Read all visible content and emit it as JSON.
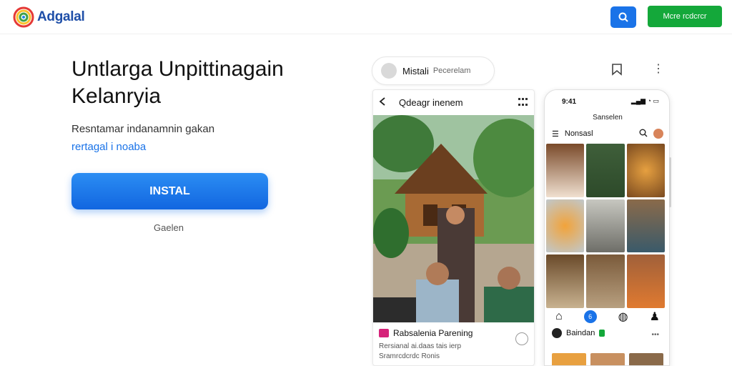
{
  "header": {
    "brand": "Adgalal",
    "more_label": "Mcre rcdcrcr"
  },
  "hero": {
    "headline": "Untlarga Unpittinagain Kelanryia",
    "subtitle": "Resntamar indanamnin gakan",
    "link": "rertagal i noaba",
    "install_label": "INSTAL",
    "secondary_label": "Gaelen"
  },
  "post": {
    "author": "Mistali",
    "author_sub": "Pecerelam",
    "search_label": "Qdeagr inenem",
    "caption_title": "Rabsalenia Parening",
    "caption_line1": "Rersianal ai.daas tais ierp",
    "caption_line2": "Sramrcdcrdc Ronis"
  },
  "phone": {
    "time": "9:41",
    "title": "Sanselen",
    "nav_label": "Nonsasl",
    "tab_badge": "6",
    "foot_name": "Baindan",
    "foot_menu": "•••"
  },
  "colors": {
    "accent": "#1a73e8",
    "cta_green": "#14a83a",
    "brand_text": "#1f4fa8"
  }
}
